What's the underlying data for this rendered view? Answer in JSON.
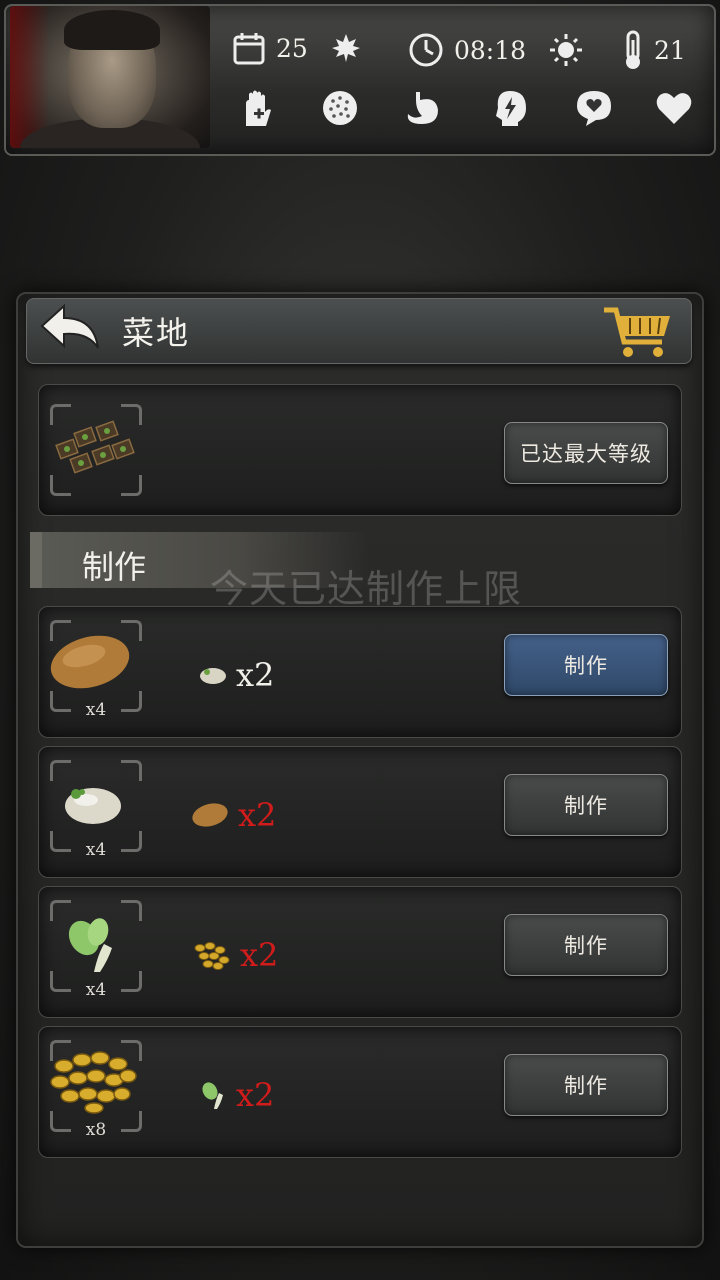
{
  "status": {
    "day": "25",
    "time": "08:18",
    "temperature": "21",
    "season_icon": "maple-leaf-icon",
    "weather_icon": "sun-icon",
    "conditions": [
      "medical-glove-icon",
      "virus-icon",
      "stomach-icon",
      "energy-head-icon",
      "mood-icon",
      "health-heart-icon"
    ]
  },
  "panel": {
    "title": "菜地"
  },
  "facility": {
    "status_label": "已达最大等级"
  },
  "crafting": {
    "section_label": "制作",
    "limit_notice": "今天已达制作上限",
    "recipes": [
      {
        "output": "potato",
        "output_qty": "x4",
        "cost_item": "cabbage",
        "cost_qty": "x2",
        "cost_ok": true,
        "button": "制作"
      },
      {
        "output": "cabbage",
        "output_qty": "x4",
        "cost_item": "potato",
        "cost_qty": "x2",
        "cost_ok": false,
        "button": "制作"
      },
      {
        "output": "bok-choy",
        "output_qty": "x4",
        "cost_item": "grain",
        "cost_qty": "x2",
        "cost_ok": false,
        "button": "制作"
      },
      {
        "output": "grain",
        "output_qty": "x8",
        "cost_item": "bok-choy",
        "cost_qty": "x2",
        "cost_ok": false,
        "button": "制作"
      }
    ]
  },
  "colors": {
    "ok": "#f2f0ea",
    "insufficient": "#d21c1c",
    "active_button": "#45618a"
  }
}
